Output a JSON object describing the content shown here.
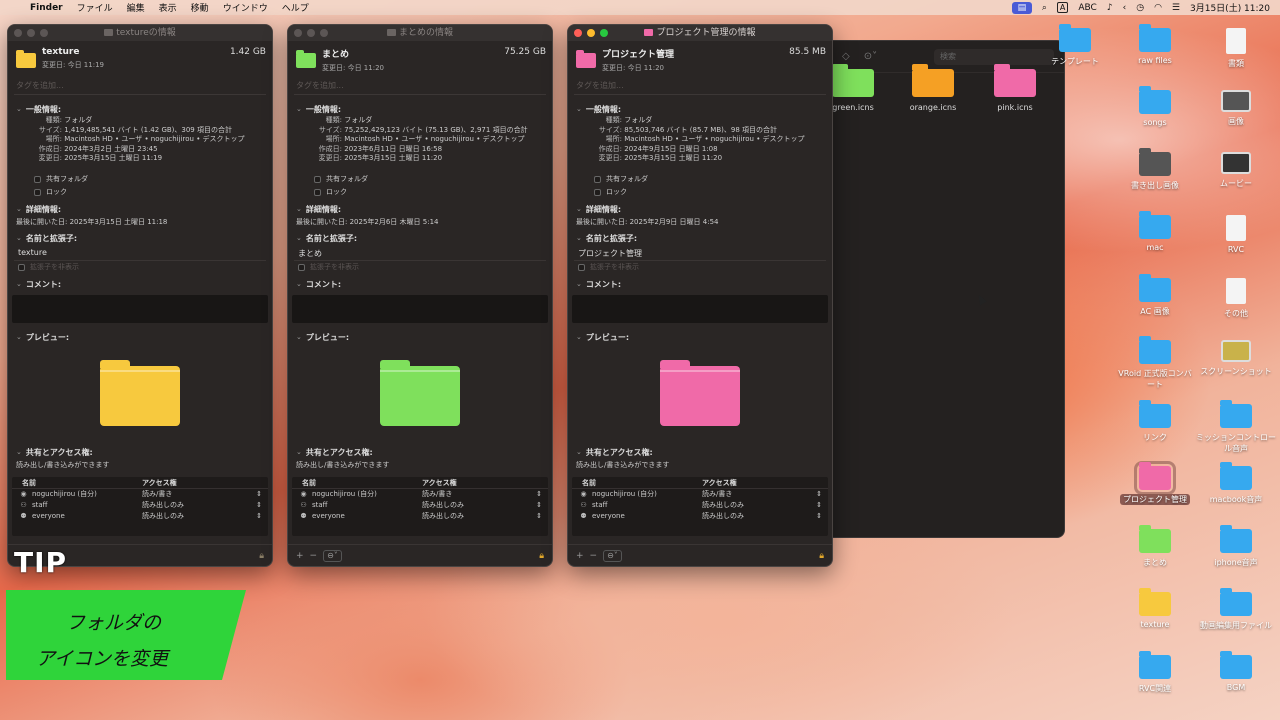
{
  "menubar": {
    "app": "Finder",
    "items": [
      "ファイル",
      "編集",
      "表示",
      "移動",
      "ウインドウ",
      "ヘルプ"
    ],
    "input_label": "ABC",
    "datetime": "3月15日(土)  11:20"
  },
  "windows": [
    {
      "title": "textureの情報",
      "name": "texture",
      "size": "1.42 GB",
      "modified_short": "変更日: 今日 11:19",
      "tag_placeholder": "タグを追加...",
      "general_header": "一般情報:",
      "kind": "フォルダ",
      "size_detail": "1,419,485,541 バイト (1.42 GB)、309 項目の合計",
      "where": "Macintosh HD • ユーザ • noguchijirou • デスクトップ",
      "created": "2024年3月2日 土曜日 23:45",
      "modified": "2025年3月15日 土曜日 11:19",
      "shared_folder": "共有フォルダ",
      "locked": "ロック",
      "more_header": "詳細情報:",
      "last_opened": "最後に開いた日: 2025年3月15日 土曜日 11:18",
      "name_header": "名前と拡張子:",
      "name_value": "texture",
      "hide_ext": "拡張子を非表示",
      "comment_header": "コメント:",
      "preview_header": "プレビュー:",
      "folder_color": "#f7c93e",
      "sharing_header": "共有とアクセス権:",
      "sharing_note": "読み出し/書き込みができます",
      "col_name": "名前",
      "col_access": "アクセス権",
      "perms": [
        {
          "user": "noguchijirou (自分)",
          "access": "読み/書き",
          "icon": "person-icon"
        },
        {
          "user": "staff",
          "access": "読み出しのみ",
          "icon": "group-icon"
        },
        {
          "user": "everyone",
          "access": "読み出しのみ",
          "icon": "everyone-icon"
        }
      ],
      "active": false,
      "bottom_controls": false
    },
    {
      "title": "まとめの情報",
      "name": "まとめ",
      "size": "75.25 GB",
      "modified_short": "変更日: 今日 11:20",
      "tag_placeholder": "タグを追加...",
      "general_header": "一般情報:",
      "kind": "フォルダ",
      "size_detail": "75,252,429,123 バイト (75.13 GB)、2,971 項目の合計",
      "where": "Macintosh HD • ユーザ • noguchijirou • デスクトップ",
      "created": "2023年6月11日 日曜日 16:58",
      "modified": "2025年3月15日 土曜日 11:20",
      "shared_folder": "共有フォルダ",
      "locked": "ロック",
      "more_header": "詳細情報:",
      "last_opened": "最後に開いた日: 2025年2月6日 木曜日 5:14",
      "name_header": "名前と拡張子:",
      "name_value": "まとめ",
      "hide_ext": "拡張子を非表示",
      "comment_header": "コメント:",
      "preview_header": "プレビュー:",
      "folder_color": "#7fe05c",
      "sharing_header": "共有とアクセス権:",
      "sharing_note": "読み出し/書き込みができます",
      "col_name": "名前",
      "col_access": "アクセス権",
      "perms": [
        {
          "user": "noguchijirou (自分)",
          "access": "読み/書き",
          "icon": "person-icon"
        },
        {
          "user": "staff",
          "access": "読み出しのみ",
          "icon": "group-icon"
        },
        {
          "user": "everyone",
          "access": "読み出しのみ",
          "icon": "everyone-icon"
        }
      ],
      "active": false,
      "bottom_controls": true
    },
    {
      "title": "プロジェクト管理の情報",
      "name": "プロジェクト管理",
      "size": "85.5 MB",
      "modified_short": "変更日: 今日 11:20",
      "tag_placeholder": "タグを追加...",
      "general_header": "一般情報:",
      "kind": "フォルダ",
      "size_detail": "85,503,746 バイト (85.7 MB)、98 項目の合計",
      "where": "Macintosh HD • ユーザ • noguchijirou • デスクトップ",
      "created": "2024年9月15日 日曜日 1:08",
      "modified": "2025年3月15日 土曜日 11:20",
      "shared_folder": "共有フォルダ",
      "locked": "ロック",
      "more_header": "詳細情報:",
      "last_opened": "最後に開いた日: 2025年2月9日 日曜日 4:54",
      "name_header": "名前と拡張子:",
      "name_value": "プロジェクト管理",
      "hide_ext": "拡張子を非表示",
      "comment_header": "コメント:",
      "preview_header": "プレビュー:",
      "folder_color": "#f06aa8",
      "sharing_header": "共有とアクセス権:",
      "sharing_note": "読み出し/書き込みができます",
      "col_name": "名前",
      "col_access": "アクセス権",
      "perms": [
        {
          "user": "noguchijirou (自分)",
          "access": "読み/書き",
          "icon": "person-icon"
        },
        {
          "user": "staff",
          "access": "読み出しのみ",
          "icon": "group-icon"
        },
        {
          "user": "everyone",
          "access": "読み出しのみ",
          "icon": "everyone-icon"
        }
      ],
      "active": true,
      "bottom_controls": true
    }
  ],
  "labels": {
    "kind": "種類:",
    "size": "サイズ:",
    "where": "場所:",
    "created": "作成日:",
    "modified": "変更日:"
  },
  "finder": {
    "search_placeholder": "検索",
    "items": [
      {
        "label": "green.icns",
        "color": "#7fe05c"
      },
      {
        "label": "orange.icns",
        "color": "#f5a024"
      },
      {
        "label": "pink.icns",
        "color": "#f06aa8"
      }
    ]
  },
  "desktop": [
    {
      "label": "テンプレート",
      "kind": "folder",
      "color": "#36a9ef"
    },
    {
      "label": "raw files",
      "kind": "folder",
      "color": "#36a9ef"
    },
    {
      "label": "書類",
      "kind": "file",
      "color": "#f4f4f4"
    },
    {
      "label": "songs",
      "kind": "folder",
      "color": "#36a9ef"
    },
    {
      "label": "画像",
      "kind": "img",
      "color": "#555555"
    },
    {
      "label": "書き出し画像",
      "kind": "folder",
      "color": "#555555"
    },
    {
      "label": "ムービー",
      "kind": "img",
      "color": "#333333"
    },
    {
      "label": "mac",
      "kind": "folder",
      "color": "#36a9ef"
    },
    {
      "label": "RVC",
      "kind": "file",
      "color": "#f4f4f4"
    },
    {
      "label": "AC 画像",
      "kind": "folder",
      "color": "#36a9ef"
    },
    {
      "label": "その他",
      "kind": "file",
      "color": "#f4f4f4"
    },
    {
      "label": "VRoid 正式版コンバート",
      "kind": "folder",
      "color": "#36a9ef"
    },
    {
      "label": "スクリーンショット",
      "kind": "img",
      "color": "#c9b24a"
    },
    {
      "label": "リンク",
      "kind": "folder",
      "color": "#36a9ef"
    },
    {
      "label": "ミッションコントロール音声",
      "kind": "folder",
      "color": "#36a9ef"
    },
    {
      "label": "プロジェクト管理",
      "kind": "folder",
      "color": "#f06aa8",
      "selected": true
    },
    {
      "label": "macbook音声",
      "kind": "folder",
      "color": "#36a9ef"
    },
    {
      "label": "まとめ",
      "kind": "folder",
      "color": "#7fe05c"
    },
    {
      "label": "iphone音声",
      "kind": "folder",
      "color": "#36a9ef"
    },
    {
      "label": "texture",
      "kind": "folder",
      "color": "#f7c93e"
    },
    {
      "label": "動画編集用ファイル",
      "kind": "folder",
      "color": "#36a9ef"
    },
    {
      "label": "RVC関連",
      "kind": "folder",
      "color": "#36a9ef"
    },
    {
      "label": "BGM",
      "kind": "folder",
      "color": "#36a9ef"
    }
  ],
  "overlay": {
    "tip": "TIP",
    "line1": "フォルダの",
    "line2": "アイコンを変更"
  }
}
